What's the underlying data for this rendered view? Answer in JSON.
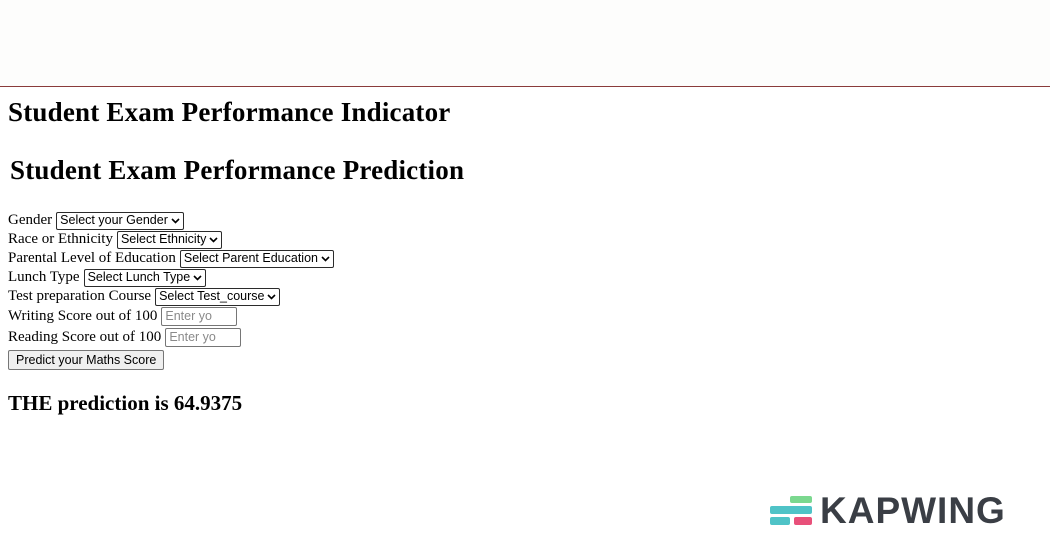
{
  "header": {
    "title": "Student Exam Performance Indicator",
    "subtitle": "Student Exam Performance Prediction"
  },
  "form": {
    "gender": {
      "label": "Gender",
      "selected": "Select your Gender"
    },
    "ethnicity": {
      "label": "Race or Ethnicity",
      "selected": "Select Ethnicity"
    },
    "parent_education": {
      "label": "Parental Level of Education",
      "selected": "Select Parent Education"
    },
    "lunch": {
      "label": "Lunch Type",
      "selected": "Select Lunch Type"
    },
    "test_course": {
      "label": "Test preparation Course",
      "selected": "Select Test_course"
    },
    "writing": {
      "label": "Writing Score out of 100",
      "placeholder": "Enter yo"
    },
    "reading": {
      "label": "Reading Score out of 100",
      "placeholder": "Enter yo"
    },
    "submit_label": "Predict your Maths Score"
  },
  "result": {
    "text": "THE prediction is 64.9375"
  },
  "watermark": {
    "text": "KAPWING",
    "colors": {
      "green": "#7bd88f",
      "teal": "#4fc3c7",
      "pink": "#e8507a",
      "text": "#3a3e45"
    }
  }
}
